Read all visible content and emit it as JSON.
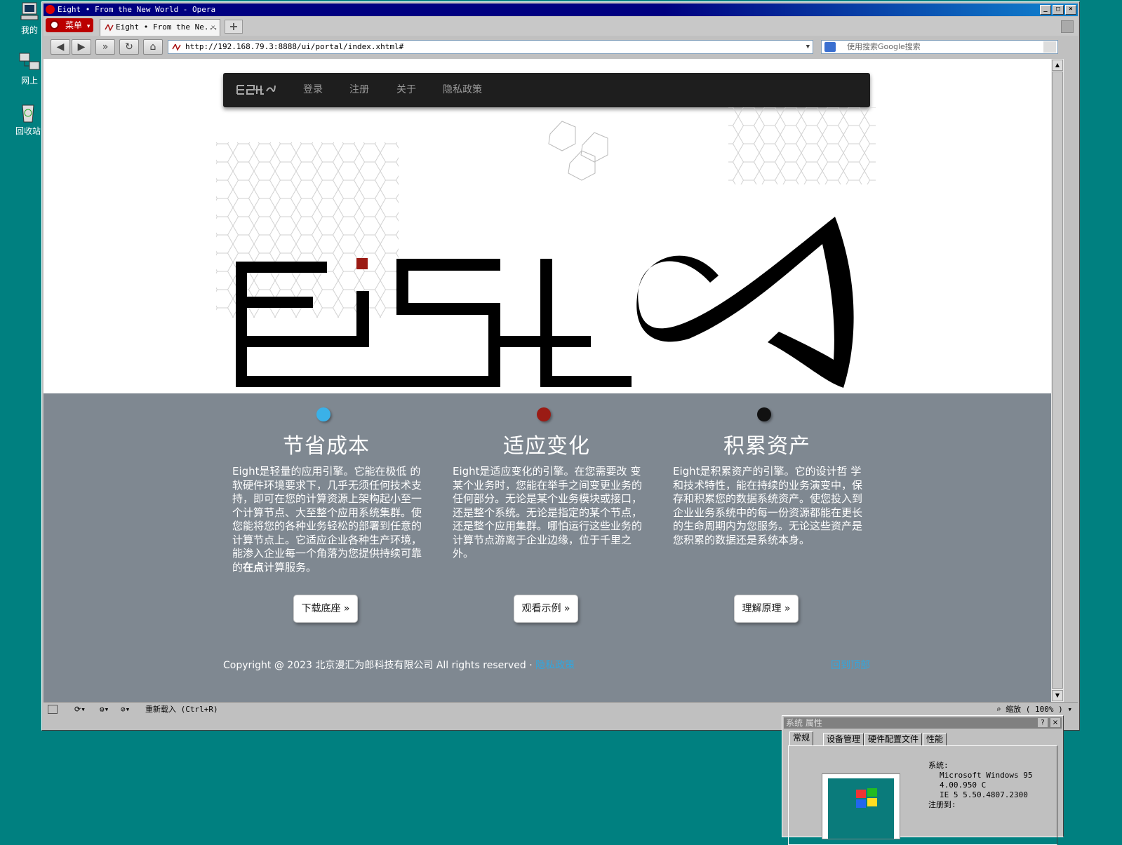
{
  "desktop": {
    "icons": [
      {
        "label": "我的"
      },
      {
        "label": "网上"
      },
      {
        "label": "回收站"
      }
    ]
  },
  "window": {
    "title": "Eight • From the New World - Opera",
    "menu_label": "菜单",
    "tab_title": "Eight • From the Ne...",
    "url": "http://192.168.79.3:8888/ui/portal/index.xhtml#",
    "search_placeholder": "使用搜索Google搜索"
  },
  "site": {
    "nav": {
      "login": "登录",
      "register": "注册",
      "about": "关于",
      "privacy": "隐私政策"
    },
    "features": [
      {
        "dot_color": "#3ab1e8",
        "title": "节省成本",
        "text_a": "Eight是轻量的应用引擎。它能在极低 的软硬件环境要求下，几乎无须任何技术支持，即可在您的计算资源上架构起小至一个计算节点、大至整个应用系统集群。使您能将您的各种业务轻松的部署到任意的计算节点上。它适应企业各种生产环境，能渗入企业每一个角落为您提供持续可靠的",
        "text_bold": "在点",
        "text_b": "计算服务。",
        "button": "下载底座 »"
      },
      {
        "dot_color": "#9b1b14",
        "title": "适应变化",
        "text_a": "Eight是适应变化的引擎。在您需要改 变某个业务时，您能在举手之间变更业务的任何部分。无论是某个业务模块或接口，还是整个系统。无论是指定的某个节点，还是整个应用集群。哪怕运行这些业务的计算节点游离于企业边缘，位于千里之外。",
        "text_bold": "",
        "text_b": "",
        "button": "观看示例 »"
      },
      {
        "dot_color": "#111111",
        "title": "积累资产",
        "text_a": "Eight是积累资产的引擎。它的设计哲 学和技术特性，能在持续的业务演变中，保存和积累您的数据系统资产。使您投入到企业业务系统中的每一份资源都能在更长的生命周期内为您服务。无论这些资产是您积累的数据还是系统本身。",
        "text_bold": "",
        "text_b": "",
        "button": "理解原理 »"
      }
    ],
    "footer": {
      "copyright": "Copyright @ 2023 北京漫汇为郎科技有限公司 All rights reserved · ",
      "privacy_link": "隐私政策",
      "back_to_top": "回到顶部"
    }
  },
  "statusbar": {
    "reload_hint": "重新载入 (Ctrl+R)",
    "zoom": "缩放 ( 100% )"
  },
  "system_dialog": {
    "title": "系统 属性",
    "tabs": [
      "常规",
      "设备管理",
      "硬件配置文件",
      "性能"
    ],
    "system_label": "系统:",
    "os_name": "Microsoft Windows 95",
    "os_version": "4.00.950 C",
    "ie_version": "IE 5 5.50.4807.2300",
    "registered_label": "注册到:"
  }
}
